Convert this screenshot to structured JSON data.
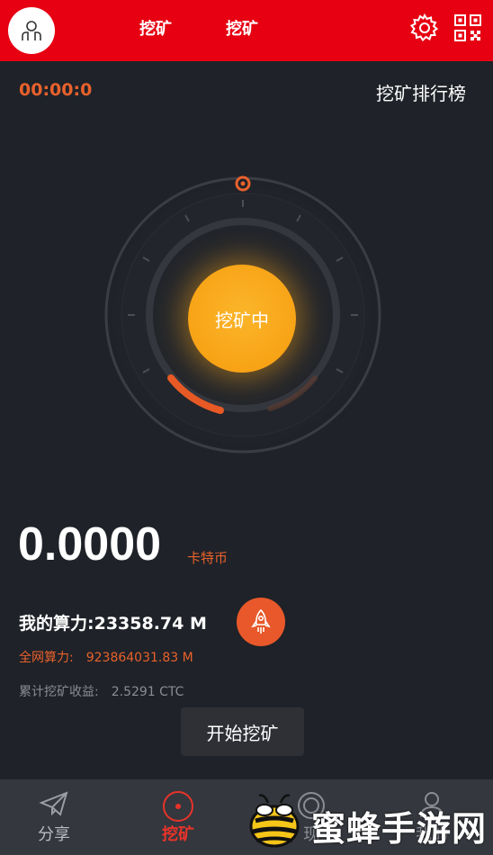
{
  "header": {
    "tabs": [
      "挖矿",
      "挖矿"
    ],
    "avatar_icon": "user-icon",
    "settings_icon": "gear-icon",
    "qr_icon": "qrcode-icon",
    "bg_color": "#e60012"
  },
  "status": {
    "timer": "00:00:0",
    "ranking_link": "挖矿排行榜"
  },
  "dial": {
    "center_label": "挖矿中",
    "accent_color": "#f8a316"
  },
  "stats": {
    "balance": "0.0000",
    "currency": "卡特币",
    "my_hashrate": "我的算力:23358.74 M",
    "network_label": "全网算力:",
    "network_value": "923864031.83 M",
    "income_label": "累计挖矿收益:",
    "income_value": "2.5291 CTC",
    "accent_color": "#e8612c"
  },
  "toast": "开始挖矿",
  "nav": [
    {
      "label": "分享",
      "icon": "paper-plane-icon"
    },
    {
      "label": "挖矿",
      "icon": "mining-icon"
    },
    {
      "label": "现",
      "icon": "withdraw-icon"
    },
    {
      "label": "我的",
      "icon": "profile-icon"
    }
  ],
  "watermark": "蜜蜂手游网"
}
